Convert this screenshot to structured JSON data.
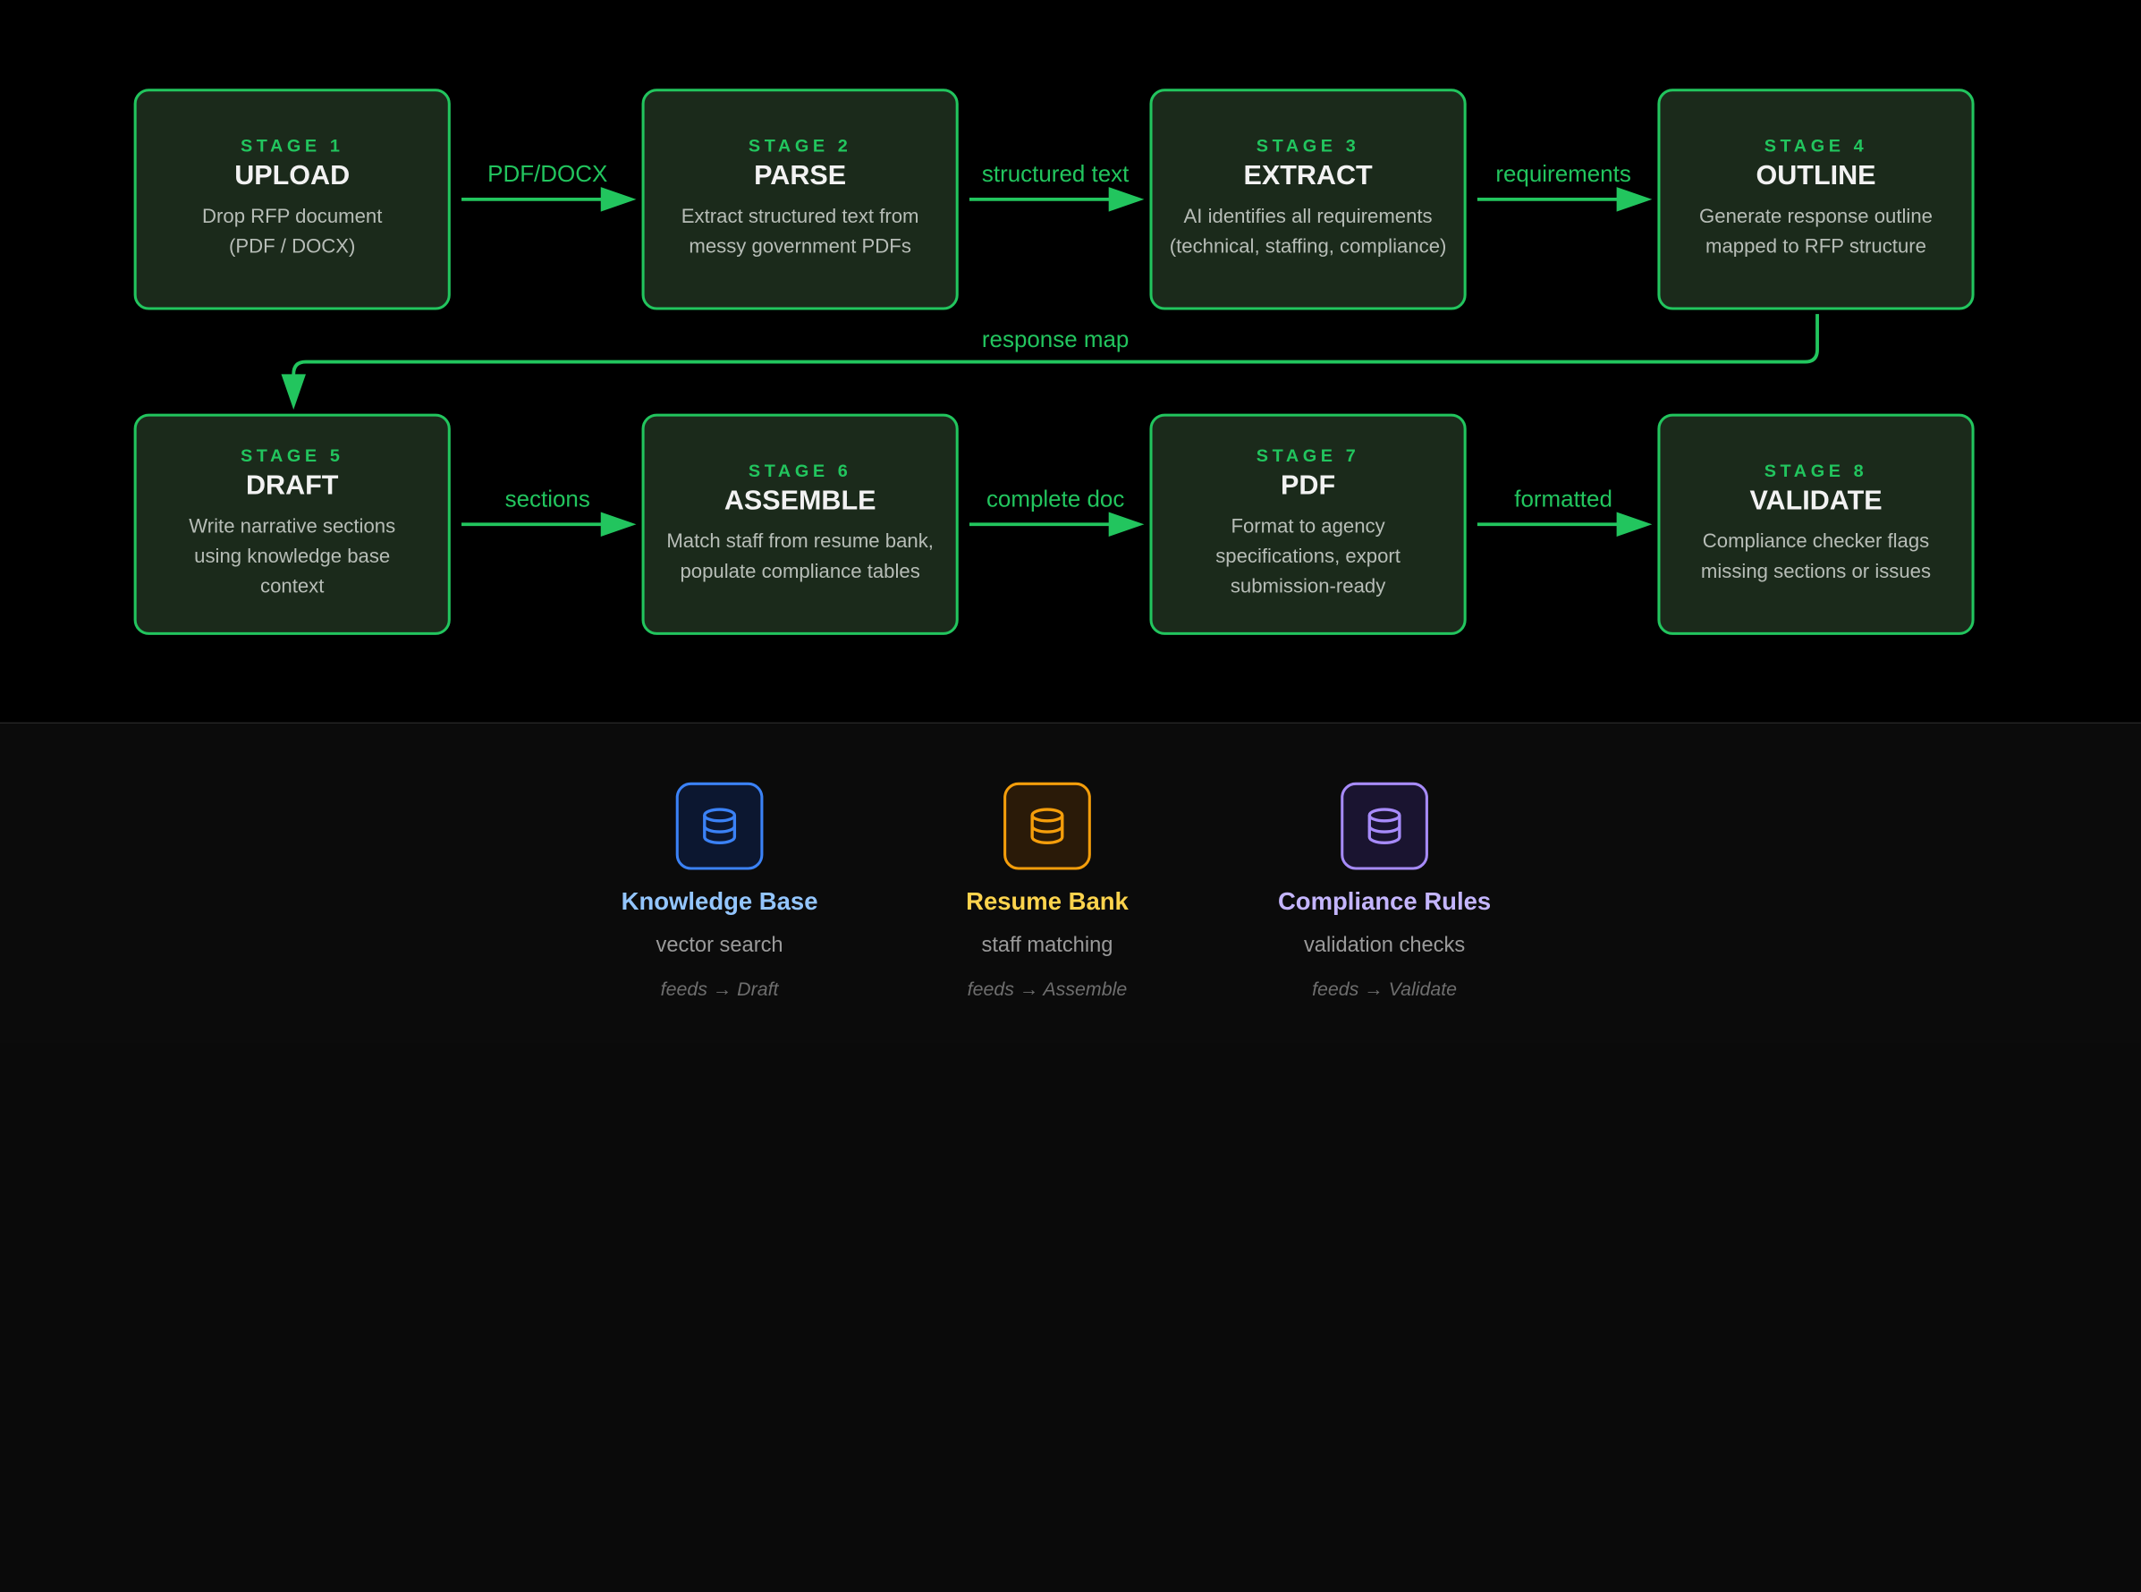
{
  "stages": [
    {
      "number": "STAGE 1",
      "name": "UPLOAD",
      "description": "Drop RFP document (PDF / DOCX)"
    },
    {
      "number": "STAGE 2",
      "name": "PARSE",
      "description": "Extract structured text from messy government PDFs"
    },
    {
      "number": "STAGE 3",
      "name": "EXTRACT",
      "description": "AI identifies all requirements (technical, staffing, compliance)"
    },
    {
      "number": "STAGE 4",
      "name": "OUTLINE",
      "description": "Generate response outline mapped to RFP structure"
    },
    {
      "number": "STAGE 5",
      "name": "DRAFT",
      "description": "Write narrative sections using knowledge base context"
    },
    {
      "number": "STAGE 6",
      "name": "ASSEMBLE",
      "description": "Match staff from resume bank, populate compliance tables"
    },
    {
      "number": "STAGE 7",
      "name": "PDF",
      "description": "Format to agency specifications, export submission-ready"
    },
    {
      "number": "STAGE 8",
      "name": "VALIDATE",
      "description": "Compliance checker flags missing sections or issues"
    }
  ],
  "edges": [
    {
      "from": "STAGE 1",
      "to": "STAGE 2",
      "label": "PDF/DOCX"
    },
    {
      "from": "STAGE 2",
      "to": "STAGE 3",
      "label": "structured text"
    },
    {
      "from": "STAGE 3",
      "to": "STAGE 4",
      "label": "requirements"
    },
    {
      "from": "STAGE 4",
      "to": "STAGE 5",
      "label": "response map"
    },
    {
      "from": "STAGE 5",
      "to": "STAGE 6",
      "label": "sections"
    },
    {
      "from": "STAGE 6",
      "to": "STAGE 7",
      "label": "complete doc"
    },
    {
      "from": "STAGE 7",
      "to": "STAGE 8",
      "label": "formatted"
    }
  ],
  "data_stores": [
    {
      "name": "Knowledge Base",
      "description": "vector search",
      "feeds": "feeds → Draft",
      "icon": "database-icon",
      "accent": "#3b82f6",
      "name_color": "#93c5fd",
      "fill": "#0c1730"
    },
    {
      "name": "Resume Bank",
      "description": "staff matching",
      "feeds": "feeds → Assemble",
      "icon": "database-icon",
      "accent": "#f59e0b",
      "name_color": "#fcd34d",
      "fill": "#2a1a08"
    },
    {
      "name": "Compliance Rules",
      "description": "validation checks",
      "feeds": "feeds → Validate",
      "icon": "database-icon",
      "accent": "#a78bfa",
      "name_color": "#c4b5fd",
      "fill": "#1a1430"
    }
  ],
  "colors": {
    "accent": "#22c55e",
    "node_fill": "#1b2a1b",
    "background": "#000000"
  }
}
